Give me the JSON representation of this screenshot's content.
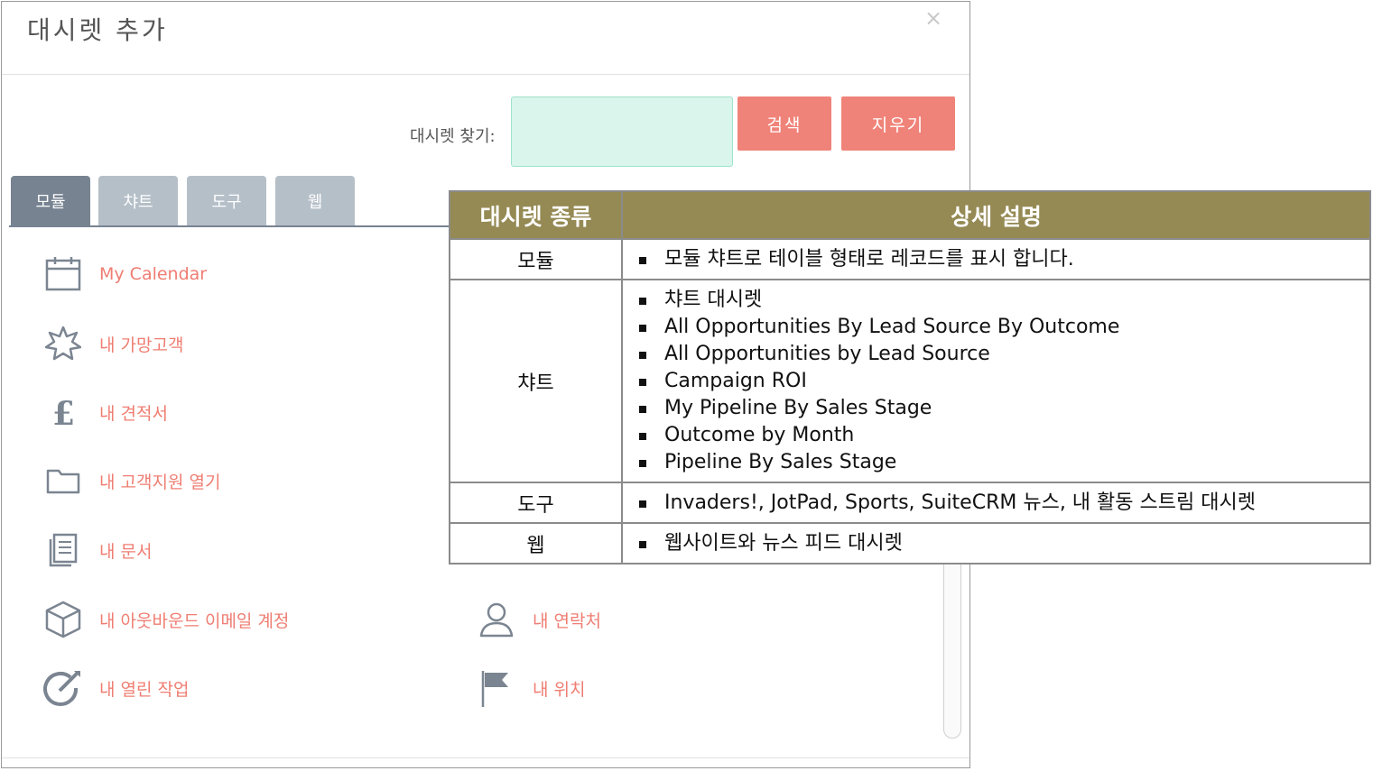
{
  "dialog": {
    "title": "대시렛 추가",
    "close_glyph": "×",
    "search_label": "대시렛 찾기:",
    "search_value": "",
    "search_button": "검색",
    "clear_button": "지우기"
  },
  "tabs": [
    {
      "label": "모듈",
      "active": true
    },
    {
      "label": "챠트",
      "active": false
    },
    {
      "label": "도구",
      "active": false
    },
    {
      "label": "웹",
      "active": false
    }
  ],
  "dashlets": [
    {
      "label": "My Calendar",
      "icon": "calendar-icon"
    },
    {
      "label": "내 가망고객",
      "icon": "star-burst-icon"
    },
    {
      "label": "내 견적서",
      "icon": "pound-icon"
    },
    {
      "label": "내 고객지원 열기",
      "icon": "folder-icon"
    },
    {
      "label": "내 문서",
      "icon": "document-icon"
    },
    {
      "label": "내 아웃바운드 이메일 계정",
      "icon": "cube-icon"
    },
    {
      "label": "내 열린 작업",
      "icon": "task-icon"
    },
    {
      "label": "내 연락처",
      "icon": "person-icon"
    },
    {
      "label": "내 위치",
      "icon": "flag-icon"
    }
  ],
  "colors": {
    "accent": "#f08379",
    "tab_active": "#778391",
    "tab_inactive": "#b5bfc8",
    "search_bg": "#d9f5ec",
    "table_header": "#958a54"
  },
  "table": {
    "headers": [
      "대시렛 종류",
      "상세 설명"
    ],
    "rows": [
      {
        "type": "모듈",
        "items": [
          "모듈 챠트로 테이블 형태로 레코드를 표시 합니다."
        ]
      },
      {
        "type": "챠트",
        "items": [
          "챠트 대시렛",
          "All Opportunities By Lead Source By Outcome",
          "All Opportunities by Lead Source",
          "Campaign ROI",
          "My Pipeline By Sales Stage",
          "Outcome by Month",
          "Pipeline By Sales Stage"
        ]
      },
      {
        "type": "도구",
        "items": [
          "Invaders!, JotPad, Sports, SuiteCRM 뉴스, 내 활동 스트림 대시렛"
        ]
      },
      {
        "type": "웹",
        "items": [
          "웹사이트와 뉴스 피드 대시렛"
        ]
      }
    ]
  }
}
